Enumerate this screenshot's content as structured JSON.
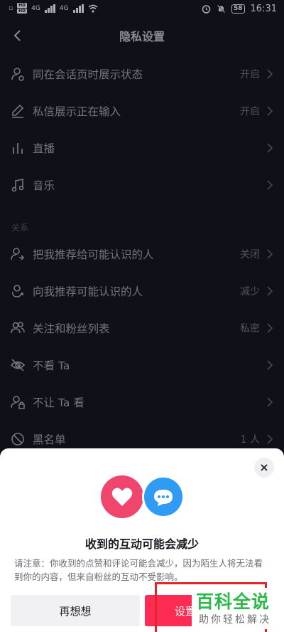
{
  "status_bar": {
    "hd1": "HD",
    "hd2": "HD",
    "net1": "4G",
    "net2": "4G",
    "battery": "58",
    "time": "16:31"
  },
  "header": {
    "title": "隐私设置"
  },
  "rows": [
    {
      "label": "同在会话页时展示状态",
      "value": "开启",
      "icon": "user-status-icon"
    },
    {
      "label": "私信展示正在输入",
      "value": "开启",
      "icon": "pen-icon"
    },
    {
      "label": "直播",
      "value": "",
      "icon": "live-bars-icon"
    },
    {
      "label": "音乐",
      "value": "",
      "icon": "music-note-icon"
    }
  ],
  "section_relations": "关系",
  "relation_rows": [
    {
      "label": "把我推荐给可能认识的人",
      "value": "关闭",
      "icon": "share-user-icon"
    },
    {
      "label": "向我推荐可能认识的人",
      "value": "减少",
      "icon": "recommend-user-icon"
    },
    {
      "label": "关注和粉丝列表",
      "value": "私密",
      "icon": "users-icon"
    },
    {
      "label": "不看 Ta",
      "value": "",
      "icon": "eye-off-icon"
    },
    {
      "label": "不让 Ta 看",
      "value": "",
      "icon": "user-lock-icon"
    },
    {
      "label": "黑名单",
      "value": "1 人",
      "icon": "block-icon"
    }
  ],
  "sheet": {
    "title": "收到的互动可能会减少",
    "description": "请注意：你收到的点赞和评论可能会减少，因为陌生人将无法看到你的内容，但来自粉丝的互动不受影响。",
    "cancel_label": "再想想",
    "confirm_label": "设置"
  },
  "watermark": {
    "title": "百科全说",
    "subtitle": "助你轻松解决"
  },
  "colors": {
    "background": "#161621",
    "accent": "#fe2c55",
    "highlight": "#e0252b",
    "watermark_green": "#2db84b"
  }
}
